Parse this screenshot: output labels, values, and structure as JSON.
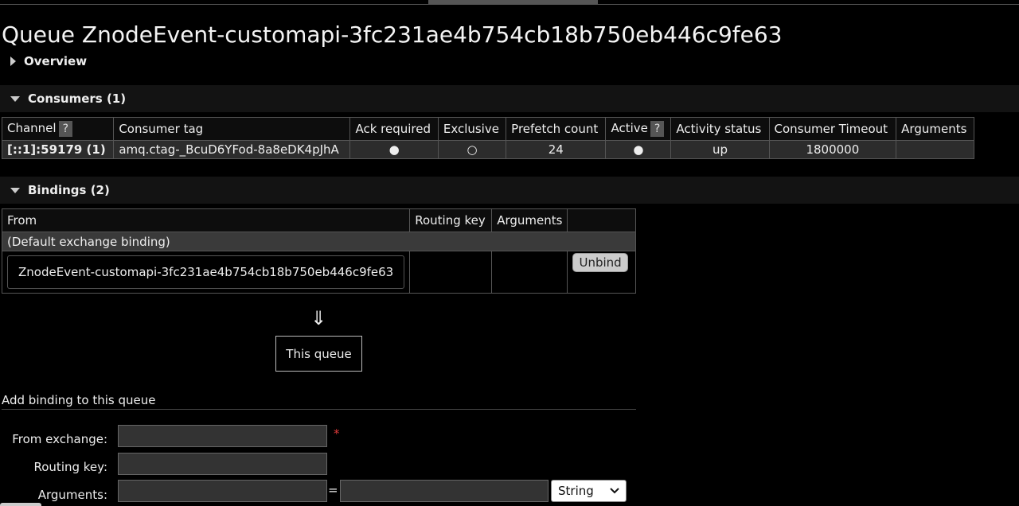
{
  "page": {
    "title": "Queue ZnodeEvent-customapi-3fc231ae4b754cb18b750eb446c9fe63"
  },
  "sections": {
    "overview": "Overview",
    "consumers": "Consumers (1)",
    "bindings": "Bindings (2)"
  },
  "consumers": {
    "headers": {
      "channel": "Channel",
      "consumer_tag": "Consumer tag",
      "ack_required": "Ack required",
      "exclusive": "Exclusive",
      "prefetch_count": "Prefetch count",
      "active": "Active",
      "activity_status": "Activity status",
      "consumer_timeout": "Consumer Timeout",
      "arguments": "Arguments"
    },
    "help_mark": "?",
    "rows": [
      {
        "channel": "[::1]:59179 (1)",
        "consumer_tag": "amq.ctag-_BcuD6YFod-8a8eDK4pJhA",
        "ack_required": "●",
        "exclusive": "○",
        "prefetch_count": "24",
        "active": "●",
        "activity_status": "up",
        "consumer_timeout": "1800000",
        "arguments": ""
      }
    ]
  },
  "bindings": {
    "headers": {
      "from": "From",
      "routing_key": "Routing key",
      "arguments": "Arguments"
    },
    "default_binding": "(Default exchange binding)",
    "rows": [
      {
        "from": "ZnodeEvent-customapi-3fc231ae4b754cb18b750eb446c9fe63",
        "routing_key": "",
        "arguments": "",
        "action": "Unbind"
      }
    ],
    "arrow": "⇓",
    "this_queue": "This queue"
  },
  "add_binding": {
    "title": "Add binding to this queue",
    "from_exchange_label": "From exchange:",
    "from_exchange_value": "",
    "required_mark": "*",
    "routing_key_label": "Routing key:",
    "routing_key_value": "",
    "arguments_label": "Arguments:",
    "arguments_key_value": "",
    "equals": "=",
    "arguments_value": "",
    "type_selected": "String"
  },
  "colors": {
    "background": "#000000",
    "row_bg": "#2c2c2c",
    "required": "#e23b3b"
  }
}
